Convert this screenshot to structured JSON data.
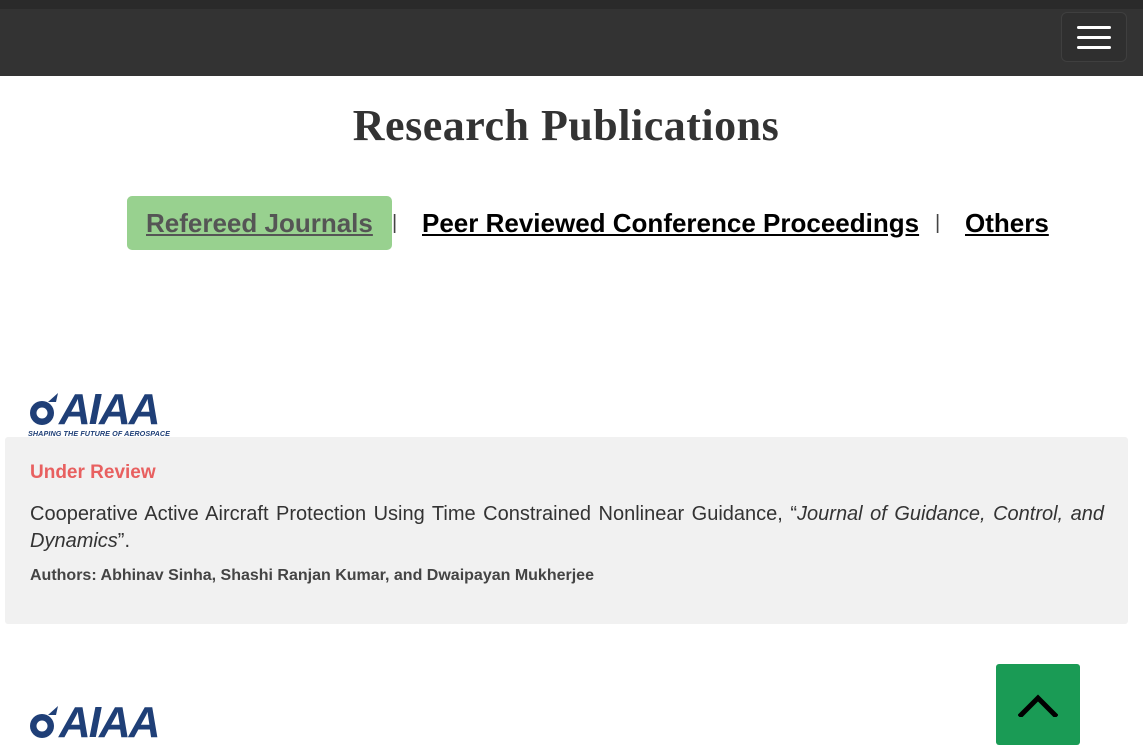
{
  "header": {
    "menu_icon": "hamburger-menu-icon"
  },
  "page": {
    "title": "Research Publications"
  },
  "tabs": [
    {
      "label": "Refereed Journals",
      "active": true
    },
    {
      "label": "Peer Reviewed Conference Proceedings",
      "active": false
    },
    {
      "label": "Others",
      "active": false
    }
  ],
  "tab_separator": "|",
  "logo": {
    "wordmark": "AIAA",
    "tagline": "SHAPING THE FUTURE OF AEROSPACE"
  },
  "publication": {
    "status": "Under Review",
    "title_prefix": "Cooperative Active Aircraft Protection Using Time Constrained Nonlinear Guidance, “",
    "journal": "Journal of Guidance, Control, and Dynamics",
    "title_suffix": "”.",
    "authors": "Authors: Abhinav Sinha, Shashi Ranjan Kumar, and Dwaipayan Mukherjee"
  },
  "scroll_top": {
    "icon": "chevron-up-icon"
  },
  "colors": {
    "topbar": "#333333",
    "active_tab": "#98d18f",
    "status": "#e86060",
    "card_bg": "#f1f1f1",
    "aiaa_blue": "#1f3f77",
    "scroll_button": "#1a9b55"
  }
}
